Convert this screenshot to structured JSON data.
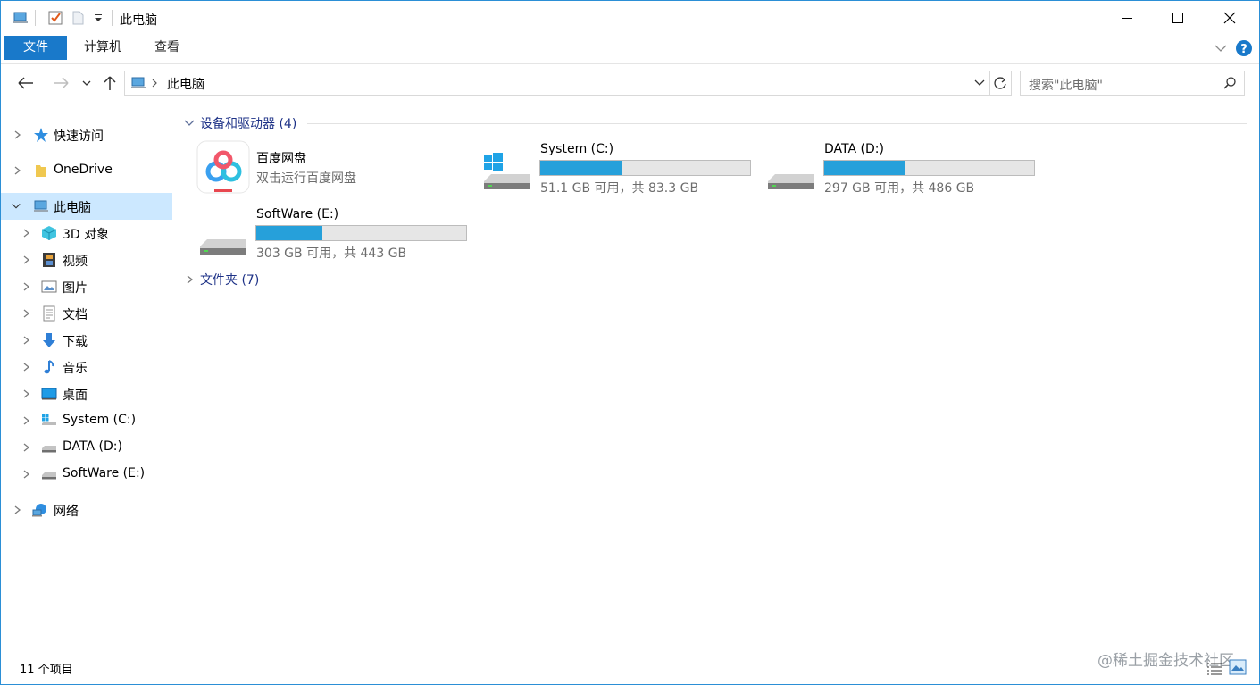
{
  "window": {
    "title": "此电脑"
  },
  "ribbon": {
    "tabs": [
      "文件",
      "计算机",
      "查看"
    ]
  },
  "address": {
    "location": "此电脑"
  },
  "search": {
    "placeholder": "搜索\"此电脑\""
  },
  "sidebar": {
    "items": [
      {
        "label": "快速访问",
        "icon": "star-icon"
      },
      {
        "label": "OneDrive",
        "icon": "folder-icon"
      },
      {
        "label": "此电脑",
        "icon": "computer-icon"
      },
      {
        "label": "3D 对象",
        "icon": "cube-icon"
      },
      {
        "label": "视频",
        "icon": "film-icon"
      },
      {
        "label": "图片",
        "icon": "picture-icon"
      },
      {
        "label": "文档",
        "icon": "document-icon"
      },
      {
        "label": "下载",
        "icon": "download-icon"
      },
      {
        "label": "音乐",
        "icon": "music-note-icon"
      },
      {
        "label": "桌面",
        "icon": "desktop-icon"
      },
      {
        "label": "System (C:)",
        "icon": "windows-drive-icon"
      },
      {
        "label": "DATA (D:)",
        "icon": "drive-icon"
      },
      {
        "label": "SoftWare (E:)",
        "icon": "drive-icon"
      },
      {
        "label": "网络",
        "icon": "network-icon"
      }
    ]
  },
  "content": {
    "devices_header": "设备和驱动器 (4)",
    "folders_header": "文件夹 (7)",
    "baidu": {
      "name": "百度网盘",
      "sub": "双击运行百度网盘"
    },
    "drives": [
      {
        "name": "System (C:)",
        "sub": "51.1 GB 可用，共 83.3 GB",
        "used_fraction": 0.387
      },
      {
        "name": "DATA (D:)",
        "sub": "297 GB 可用，共 486 GB",
        "used_fraction": 0.389
      },
      {
        "name": "SoftWare (E:)",
        "sub": "303 GB 可用，共 443 GB",
        "used_fraction": 0.316
      }
    ]
  },
  "status": {
    "count": "11 个项目"
  },
  "watermark": "@稀土掘金技术社区",
  "colors": {
    "accent": "#1979ca",
    "bar_fill": "#26a0da",
    "selection": "#cce8ff",
    "group_header": "#1e3287"
  }
}
